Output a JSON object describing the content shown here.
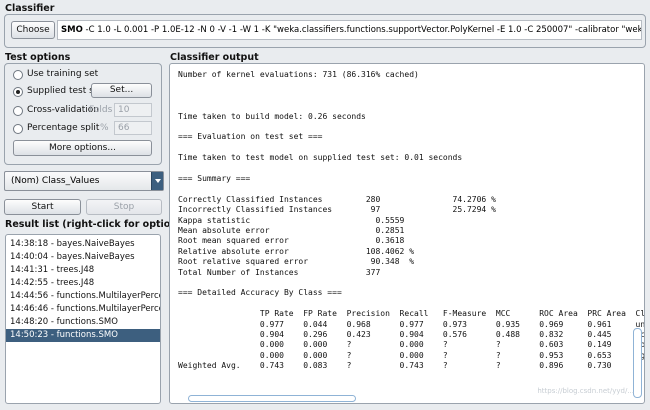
{
  "classifier": {
    "section_label": "Classifier",
    "choose_button": "Choose",
    "name": "SMO",
    "options": " -C 1.0 -L 0.001 -P 1.0E-12 -N 0 -V -1 -W 1 -K \"weka.classifiers.functions.supportVector.PolyKernel -E 1.0 -C 250007\" -calibrator \"weka.classifiers.functions.Logistic -R 1"
  },
  "test_options": {
    "section_label": "Test options",
    "use_training_set": "Use training set",
    "supplied_test_set": "Supplied test set",
    "set_button": "Set...",
    "cross_validation": "Cross-validation",
    "folds_label": "Folds",
    "folds_value": "10",
    "percentage_split": "Percentage split",
    "percent_label": "%",
    "percent_value": "66",
    "more_options_button": "More options...",
    "selected": "supplied_test_set"
  },
  "class_select": {
    "value": "(Nom) Class_Values",
    "arrow_icon": "dropdown-arrow-icon"
  },
  "actions": {
    "start": "Start",
    "stop": "Stop"
  },
  "result_list": {
    "section_label": "Result list (right-click for options)",
    "items": [
      "14:38:18 - bayes.NaiveBayes",
      "14:40:04 - bayes.NaiveBayes",
      "14:41:31 - trees.J48",
      "14:42:55 - trees.J48",
      "14:44:56 - functions.MultilayerPerceptron",
      "14:46:46 - functions.MultilayerPerceptron",
      "14:48:20 - functions.SMO",
      "14:50:23 - functions.SMO"
    ],
    "selected_index": 7
  },
  "classifier_output": {
    "section_label": "Classifier output",
    "lines": [
      "Number of kernel evaluations: 731 (86.316% cached)",
      "",
      "",
      "",
      "Time taken to build model: 0.26 seconds",
      "",
      "=== Evaluation on test set ===",
      "",
      "Time taken to test model on supplied test set: 0.01 seconds",
      "",
      "=== Summary ===",
      "",
      "Correctly Classified Instances         280               74.2706 %",
      "Incorrectly Classified Instances        97               25.7294 %",
      "Kappa statistic                          0.5559",
      "Mean absolute error                      0.2851",
      "Root mean squared error                  0.3618",
      "Relative absolute error                108.4062 %",
      "Root relative squared error             90.348  %",
      "Total Number of Instances              377",
      "",
      "=== Detailed Accuracy By Class ===",
      "",
      "                 TP Rate  FP Rate  Precision  Recall   F-Measure  MCC      ROC Area  PRC Area  Cl",
      "                 0.977    0.044    0.968      0.977    0.973      0.935    0.969     0.961     un",
      "                 0.904    0.296    0.423      0.904    0.576      0.488    0.832     0.445     ac",
      "                 0.000    0.000    ?          0.000    ?          ?        0.603     0.149     go",
      "                 0.000    0.000    ?          0.000    ?          ?        0.953     0.653     vg",
      "Weighted Avg.    0.743    0.083    ?          0.743    ?          ?        0.896     0.730"
    ]
  },
  "watermark": "https://blog.csdn.net/yyd/...",
  "colors": {
    "selection": "#3d5f7f",
    "background": "#e9ecef"
  }
}
